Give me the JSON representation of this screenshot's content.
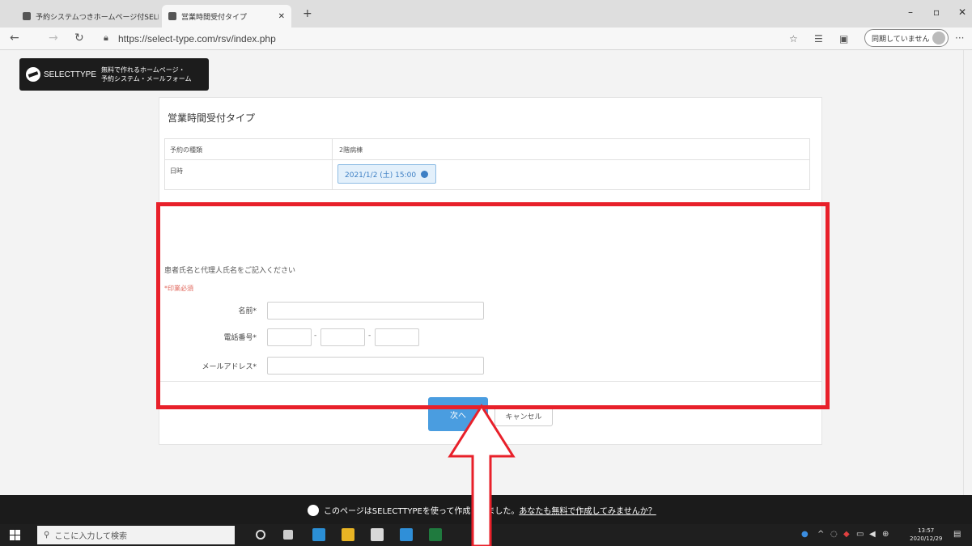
{
  "browser": {
    "tabs": [
      {
        "label": "予約システムつきホームページ付SELEC",
        "active": false
      },
      {
        "label": "営業時間受付タイプ",
        "active": true
      }
    ],
    "url": "https://select-type.com/rsv/index.php",
    "profile_label": "同期していません"
  },
  "logo": {
    "brand": "SELECTTYPE",
    "tagline_1": "無料で作れるホームページ・",
    "tagline_2": "予約システム・メールフォーム"
  },
  "card": {
    "title": "営業時間受付タイプ",
    "rows": [
      {
        "label": "予約の種類",
        "value": "2階病棟"
      },
      {
        "label": "日時",
        "value": "2021/1/2 (土) 15:00"
      }
    ],
    "prompt": "患者氏名と代理人氏名をご記入ください",
    "required_note": "*印業必須",
    "fields": {
      "name_label": "名前*",
      "phone_label": "電話番号*",
      "email_label": "メールアドレス*",
      "dash": "-"
    },
    "next_button": "次へ",
    "cancel_button": "キャンセル"
  },
  "promo": {
    "text": "このページはSELECTTYPEを使って作成されました。",
    "link": "あなたも無料で作成してみませんか？"
  },
  "taskbar": {
    "search_placeholder": "ここに入力して検索",
    "time": "13:57",
    "date": "2020/12/29"
  },
  "colors": {
    "highlight": "#e8202a",
    "primary_button": "#4a9de0",
    "required": "#e0655a"
  }
}
